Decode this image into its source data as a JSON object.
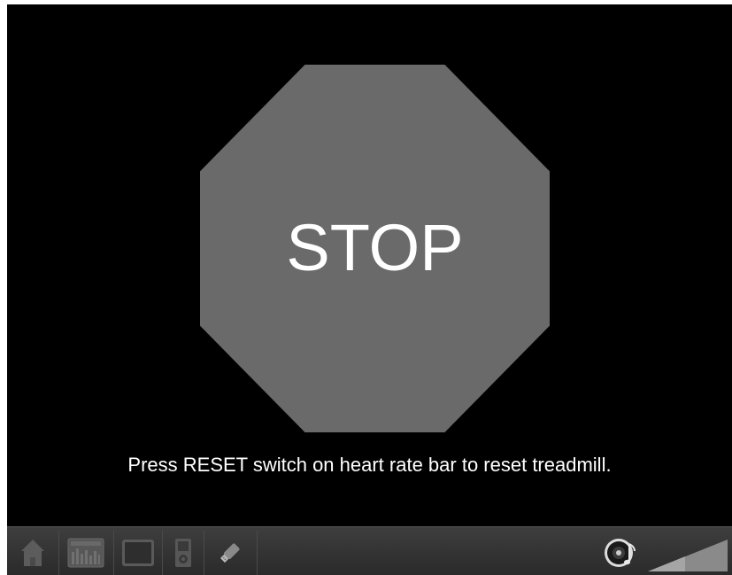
{
  "stop_screen": {
    "stop_label": "STOP",
    "message": "Press RESET switch on heart rate bar to reset treadmill."
  },
  "taskbar": {
    "buttons": [
      {
        "name": "home",
        "icon": "home-icon"
      },
      {
        "name": "program",
        "icon": "program-chart-icon"
      },
      {
        "name": "tv",
        "icon": "tv-screen-icon"
      },
      {
        "name": "media-player",
        "icon": "media-player-icon"
      },
      {
        "name": "usb",
        "icon": "usb-drive-icon"
      }
    ],
    "audio_icon": "speaker-music-icon",
    "volume_icon": "volume-wedge-icon"
  },
  "colors": {
    "background": "#000000",
    "stop_sign": "#6a6a6a",
    "text": "#ffffff",
    "taskbar": "#333333"
  }
}
